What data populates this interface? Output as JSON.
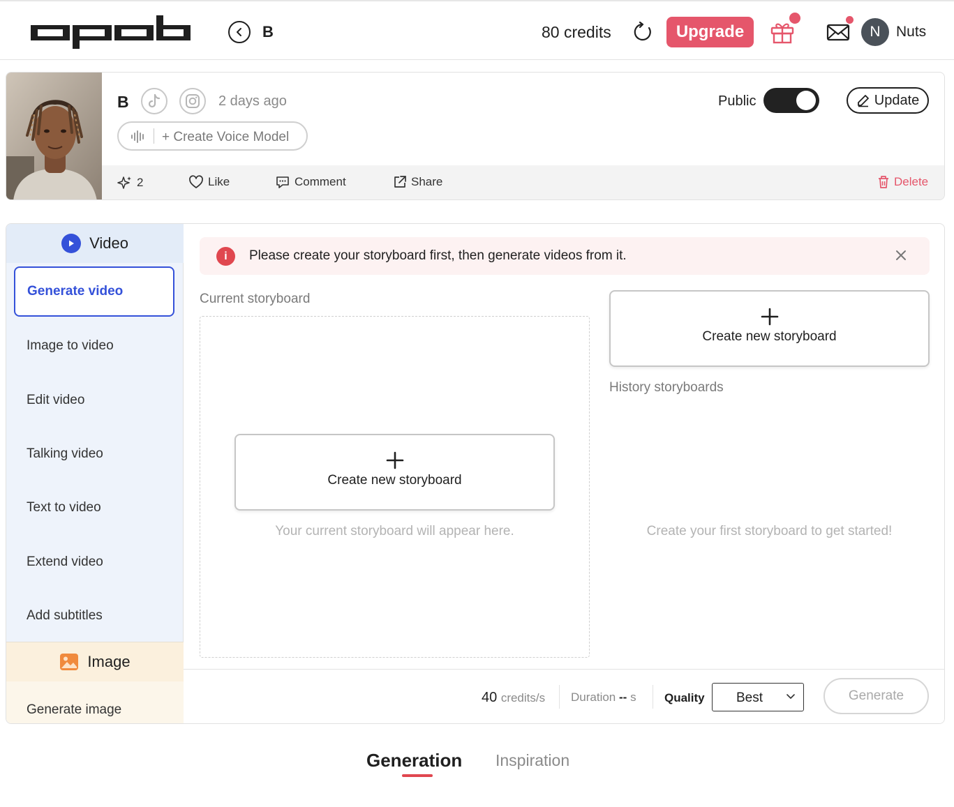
{
  "header": {
    "logo_text": "opob",
    "title": "B",
    "credits": "80 credits",
    "upgrade_label": "Upgrade",
    "avatar_initial": "N",
    "username": "Nuts",
    "icons": [
      "back-icon",
      "refresh-icon",
      "gift-icon",
      "mail-icon"
    ]
  },
  "profile": {
    "name": "B",
    "time": "2 days ago",
    "voice_model_label": "+ Create Voice Model",
    "public_label": "Public",
    "public_enabled": true,
    "update_label": "Update",
    "social_icons": [
      "tiktok-icon",
      "instagram-icon"
    ],
    "actions": {
      "sparkle_count": "2",
      "like": "Like",
      "comment": "Comment",
      "share": "Share",
      "delete": "Delete"
    }
  },
  "sidebar": {
    "video_header": "Video",
    "items": [
      {
        "label": "Generate video",
        "active": true
      },
      {
        "label": "Image to video"
      },
      {
        "label": "Edit video"
      },
      {
        "label": "Talking video"
      },
      {
        "label": "Text to video"
      },
      {
        "label": "Extend video"
      },
      {
        "label": "Add subtitles"
      }
    ],
    "image_header": "Image",
    "image_items": [
      {
        "label": "Generate image"
      }
    ]
  },
  "main": {
    "alert_message": "Please create your storyboard first, then generate videos from it.",
    "current_label": "Current storyboard",
    "create_label": "Create new storyboard",
    "current_hint": "Your current storyboard will appear here.",
    "history_label": "History storyboards",
    "history_hint": "Create your first storyboard to get started!"
  },
  "footer_bar": {
    "credits_value": "40",
    "credits_unit": "credits/s",
    "duration_label": "Duration",
    "duration_value": "--",
    "duration_unit": "s",
    "quality_label": "Quality",
    "quality_value": "Best",
    "generate_label": "Generate"
  },
  "tabs": {
    "generation": "Generation",
    "inspiration": "Inspiration",
    "active": "generation"
  },
  "colors": {
    "accent_blue": "#3451d9",
    "accent_red": "#e5566b",
    "video_bg": "#eef3fb",
    "image_bg": "#fcf6ea"
  }
}
